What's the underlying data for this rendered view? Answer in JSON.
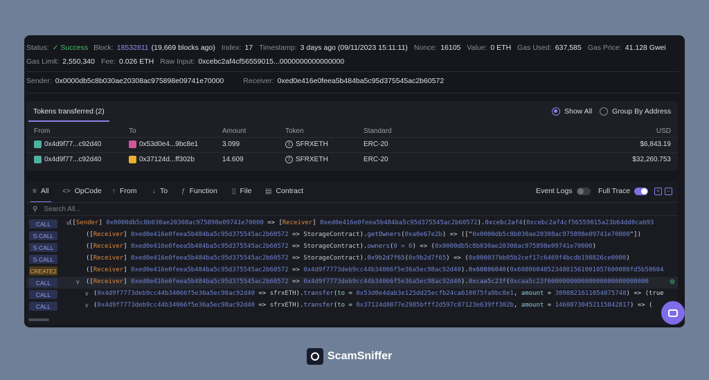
{
  "meta": {
    "status_label": "Status:",
    "status_value": "✓ Success",
    "block_label": "Block:",
    "block_value": "18532811",
    "block_note": "(19,669 blocks ago)",
    "index_label": "Index:",
    "index_value": "17",
    "timestamp_label": "Timestamp:",
    "timestamp_value": "3 days ago (09/11/2023 15:11:11)",
    "nonce_label": "Nonce:",
    "nonce_value": "16105",
    "value_label": "Value:",
    "value_value": "0 ETH",
    "gasused_label": "Gas Used:",
    "gasused_value": "637,585",
    "gasprice_label": "Gas Price:",
    "gasprice_value": "41.128 Gwei",
    "gaslimit_label": "Gas Limit:",
    "gaslimit_value": "2,550,340",
    "fee_label": "Fee:",
    "fee_value": "0.026 ETH",
    "rawinput_label": "Raw Input:",
    "rawinput_value": "0xcebc2af4cf56559015...0000000000000000",
    "sender_label": "Sender:",
    "sender_value": "0x0000db5c8b030ae20308ac975898e09741e70000",
    "receiver_label": "Receiver:",
    "receiver_value": "0xed0e416e0feea5b484ba5c95d375545ac2b60572"
  },
  "tokens": {
    "tab_label": "Tokens transferred (2)",
    "show_all": "Show All",
    "group_by": "Group By Address",
    "headers": {
      "from": "From",
      "to": "To",
      "amount": "Amount",
      "token": "Token",
      "standard": "Standard",
      "usd": "USD"
    },
    "rows": [
      {
        "from": "0x4d9f77...c92d40",
        "to": "0x53d0e4...9bc8e1",
        "amount": "3.099",
        "token": "SFRXETH",
        "standard": "ERC-20",
        "usd": "$6,843.19",
        "to_color": "#d0559a"
      },
      {
        "from": "0x4d9f77...c92d40",
        "to": "0x37124d...ff302b",
        "amount": "14.609",
        "token": "SFRXETH",
        "standard": "ERC-20",
        "usd": "$32,260.753",
        "to_color": "#e8b02d"
      }
    ],
    "from_color": "#4fb0a0"
  },
  "trace": {
    "tabs": [
      {
        "icon": "≡",
        "label": "All"
      },
      {
        "icon": "<>",
        "label": "OpCode"
      },
      {
        "icon": "↑",
        "label": "From"
      },
      {
        "icon": "↓",
        "label": "To"
      },
      {
        "icon": "ƒ",
        "label": "Function"
      },
      {
        "icon": "▯",
        "label": "File"
      },
      {
        "icon": "▤",
        "label": "Contract"
      }
    ],
    "event_logs": "Event Logs",
    "full_trace": "Full Trace",
    "search_placeholder": "Search All...",
    "rows": [
      {
        "type": "CALL",
        "chev": "∨",
        "parts": [
          [
            "w",
            "(["
          ],
          [
            "o",
            "Sender"
          ],
          [
            "w",
            "] "
          ],
          [
            "p",
            "0x0000db5c8b030ae20308ac975898e09741e70000"
          ],
          [
            "w",
            " => ["
          ],
          [
            "o",
            "Receiver"
          ],
          [
            "w",
            "] "
          ],
          [
            "p",
            "0xed0e416e0feea5b484ba5c95d375545ac2b60572"
          ],
          [
            "w",
            ")."
          ],
          [
            "f",
            "0xcebc2af4"
          ],
          [
            "w",
            "("
          ],
          [
            "p",
            "0xcebc2af4cf56559015a23b64dd0cab93"
          ]
        ]
      },
      {
        "type": "S·CALL",
        "chev": "",
        "parts": [
          [
            "w",
            "(["
          ],
          [
            "o",
            "Receiver"
          ],
          [
            "w",
            "] "
          ],
          [
            "p",
            "0xed0e416e0feea5b484ba5c95d375545ac2b60572"
          ],
          [
            "w",
            " => "
          ],
          [
            "a",
            "StorageContract"
          ],
          [
            "w",
            ")."
          ],
          [
            "f",
            "getOwners"
          ],
          [
            "w",
            "("
          ],
          [
            "p",
            "0xa0e67e2b"
          ],
          [
            "w",
            ") => ([\""
          ],
          [
            "p",
            "0x0000db5c8b030ae20308ac975898e09741e70000"
          ],
          [
            "w",
            "\"])"
          ]
        ]
      },
      {
        "type": "S·CALL",
        "chev": "",
        "parts": [
          [
            "w",
            "(["
          ],
          [
            "o",
            "Receiver"
          ],
          [
            "w",
            "] "
          ],
          [
            "p",
            "0xed0e416e0feea5b484ba5c95d375545ac2b60572"
          ],
          [
            "w",
            " => "
          ],
          [
            "a",
            "StorageContract"
          ],
          [
            "w",
            ")."
          ],
          [
            "f",
            "owners"
          ],
          [
            "w",
            "("
          ],
          [
            "p",
            "0 = 0"
          ],
          [
            "w",
            ") => ("
          ],
          [
            "p",
            "0x0000db5c8b030ae20308ac975898e09741e70000"
          ],
          [
            "w",
            ")"
          ]
        ]
      },
      {
        "type": "S·CALL",
        "chev": "",
        "parts": [
          [
            "w",
            "(["
          ],
          [
            "o",
            "Receiver"
          ],
          [
            "w",
            "] "
          ],
          [
            "p",
            "0xed0e416e0feea5b484ba5c95d375545ac2b60572"
          ],
          [
            "w",
            " => "
          ],
          [
            "a",
            "StorageContract"
          ],
          [
            "w",
            ")."
          ],
          [
            "f",
            "0x9b2d7f65"
          ],
          [
            "w",
            "("
          ],
          [
            "p",
            "0x9b2d7f65"
          ],
          [
            "w",
            ") => ("
          ],
          [
            "p",
            "0x000037bb05b2cef17c6469f4bcdb198826ce0000"
          ],
          [
            "w",
            ")"
          ]
        ]
      },
      {
        "type": "CREATE2",
        "chev": "",
        "parts": [
          [
            "w",
            "(["
          ],
          [
            "o",
            "Receiver"
          ],
          [
            "w",
            "] "
          ],
          [
            "p",
            "0xed0e416e0feea5b484ba5c95d375545ac2b60572"
          ],
          [
            "w",
            " => "
          ],
          [
            "p",
            "0x4d9f7773deb9cc44b34066f5e36a5ec98ac92d40"
          ],
          [
            "w",
            ")."
          ],
          [
            "f",
            "0x60806040"
          ],
          [
            "w",
            "("
          ],
          [
            "p",
            "0x608060405234801561001057600080fd5b50604"
          ]
        ]
      },
      {
        "type": "CALL",
        "chev": "∨",
        "hl": true,
        "parts": [
          [
            "w",
            "(["
          ],
          [
            "o",
            "Receiver"
          ],
          [
            "w",
            "] "
          ],
          [
            "p",
            "0xed0e416e0feea5b484ba5c95d375545ac2b60572"
          ],
          [
            "w",
            " => "
          ],
          [
            "p",
            "0x4d9f7773deb9cc44b34066f5e36a5ec98ac92d40"
          ],
          [
            "w",
            ")."
          ],
          [
            "f",
            "0xcaa5c23f"
          ],
          [
            "w",
            "("
          ],
          [
            "p",
            "0xcaa5c23f000000000000000000000000000"
          ]
        ]
      },
      {
        "type": "CALL",
        "chev": "∨",
        "parts": [
          [
            "w",
            "("
          ],
          [
            "p",
            "0x4d9f7773deb9cc44b34066f5e36a5ec98ac92d40"
          ],
          [
            "w",
            " => "
          ],
          [
            "a",
            "sfrxETH"
          ],
          [
            "w",
            ")."
          ],
          [
            "f",
            "transfer"
          ],
          [
            "w",
            "("
          ],
          [
            "cy",
            "to"
          ],
          [
            "w",
            " = "
          ],
          [
            "p",
            "0x53d0e4dab3e125dd25ecfb24ca610075fa9bc8e1"
          ],
          [
            "w",
            ", "
          ],
          [
            "cy",
            "amount"
          ],
          [
            "w",
            " = "
          ],
          [
            "p",
            "3098821611054875748"
          ],
          [
            "w",
            ") => (true"
          ]
        ]
      },
      {
        "type": "CALL",
        "chev": "∨",
        "parts": [
          [
            "w",
            "("
          ],
          [
            "p",
            "0x4d9f7773deb9cc44b34066f5e36a5ec98ac92d40"
          ],
          [
            "w",
            " => "
          ],
          [
            "a",
            "sfrxETH"
          ],
          [
            "w",
            ")."
          ],
          [
            "f",
            "transfer"
          ],
          [
            "w",
            "("
          ],
          [
            "cy",
            "to"
          ],
          [
            "w",
            " = "
          ],
          [
            "p",
            "0x37124d8077e2985bfff2d597c87123e639ff302b"
          ],
          [
            "w",
            ", "
          ],
          [
            "cy",
            "amount"
          ],
          [
            "w",
            " = "
          ],
          [
            "p",
            "14608730452115842817"
          ],
          [
            "w",
            ") => ("
          ]
        ]
      }
    ]
  },
  "brand": {
    "name": "ScamSniffer"
  }
}
